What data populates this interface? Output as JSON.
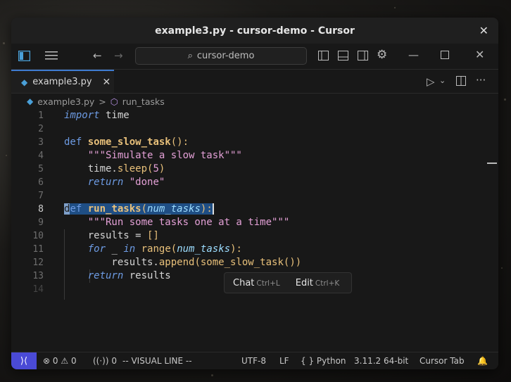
{
  "window": {
    "title": "example3.py - cursor-demo - Cursor"
  },
  "toolbar": {
    "search_text": "cursor-demo"
  },
  "tab": {
    "label": "example3.py"
  },
  "breadcrumb": {
    "file": "example3.py",
    "separator": ">",
    "symbol": "run_tasks"
  },
  "editor": {
    "line_numbers": [
      "1",
      "2",
      "3",
      "4",
      "5",
      "6",
      "7",
      "8",
      "9",
      "10",
      "11",
      "12",
      "13",
      "14"
    ],
    "current_line": "8"
  },
  "popup": {
    "chat": "Chat",
    "chat_key": "Ctrl+L",
    "edit": "Edit",
    "edit_key": "Ctrl+K"
  },
  "status": {
    "errors": "0",
    "warnings": "0",
    "ports": "0",
    "mode": "-- VISUAL LINE --",
    "encoding": "UTF-8",
    "eol": "LF",
    "language": "Python",
    "interpreter": "3.11.2 64-bit",
    "cursor_tab": "Cursor Tab"
  },
  "colors": {
    "accent": "#4a4ad6",
    "selection": "#1f4e84",
    "keyword": "#6d9be3",
    "function": "#e8c07a",
    "string": "#e3a0d6"
  },
  "icons": [
    "sidebar-toggle-icon",
    "menu-icon",
    "back-arrow-icon",
    "forward-arrow-icon",
    "search-icon",
    "layout-sidebar-left-icon",
    "layout-panel-icon",
    "layout-sidebar-right-icon",
    "settings-gear-icon",
    "minimize-icon",
    "maximize-icon",
    "close-icon",
    "python-file-icon",
    "run-icon",
    "split-editor-icon",
    "more-icon",
    "symbol-method-icon",
    "remote-icon",
    "error-icon",
    "warning-icon",
    "broadcast-icon",
    "curly-braces-icon",
    "bell-icon"
  ]
}
